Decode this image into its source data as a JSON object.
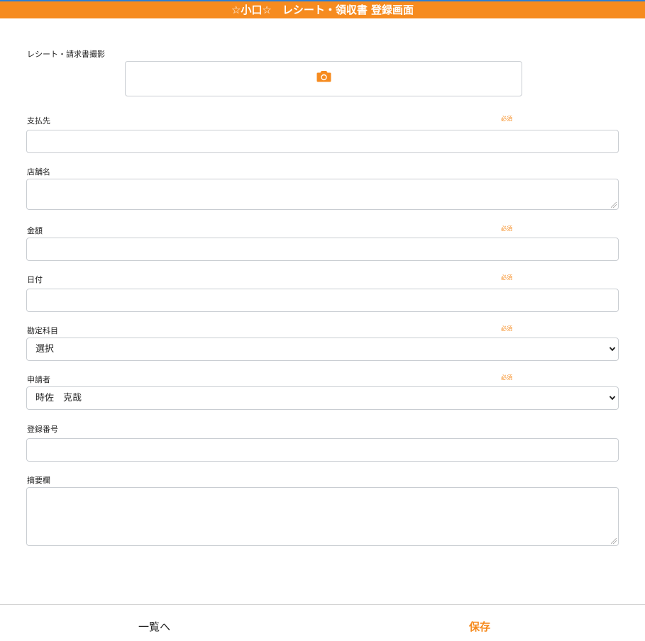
{
  "header": {
    "title": "☆小口☆　レシート・領収書 登録画面"
  },
  "photo": {
    "label": "レシート・請求書撮影",
    "icon": "camera-icon"
  },
  "required_text": "必須",
  "fields": {
    "payee": {
      "label": "支払先",
      "value": ""
    },
    "store": {
      "label": "店舗名",
      "value": ""
    },
    "amount": {
      "label": "金額",
      "value": ""
    },
    "date": {
      "label": "日付",
      "value": ""
    },
    "account": {
      "label": "勘定科目",
      "selected": "選択"
    },
    "applicant": {
      "label": "申請者",
      "selected": "時佐　克哉"
    },
    "regno": {
      "label": "登録番号",
      "value": ""
    },
    "memo": {
      "label": "摘要欄",
      "value": ""
    }
  },
  "footer": {
    "list_label": "一覧へ",
    "save_label": "保存"
  },
  "colors": {
    "accent": "#f68b1f",
    "topline": "#2b7fd6",
    "border": "#c9cdd2"
  }
}
